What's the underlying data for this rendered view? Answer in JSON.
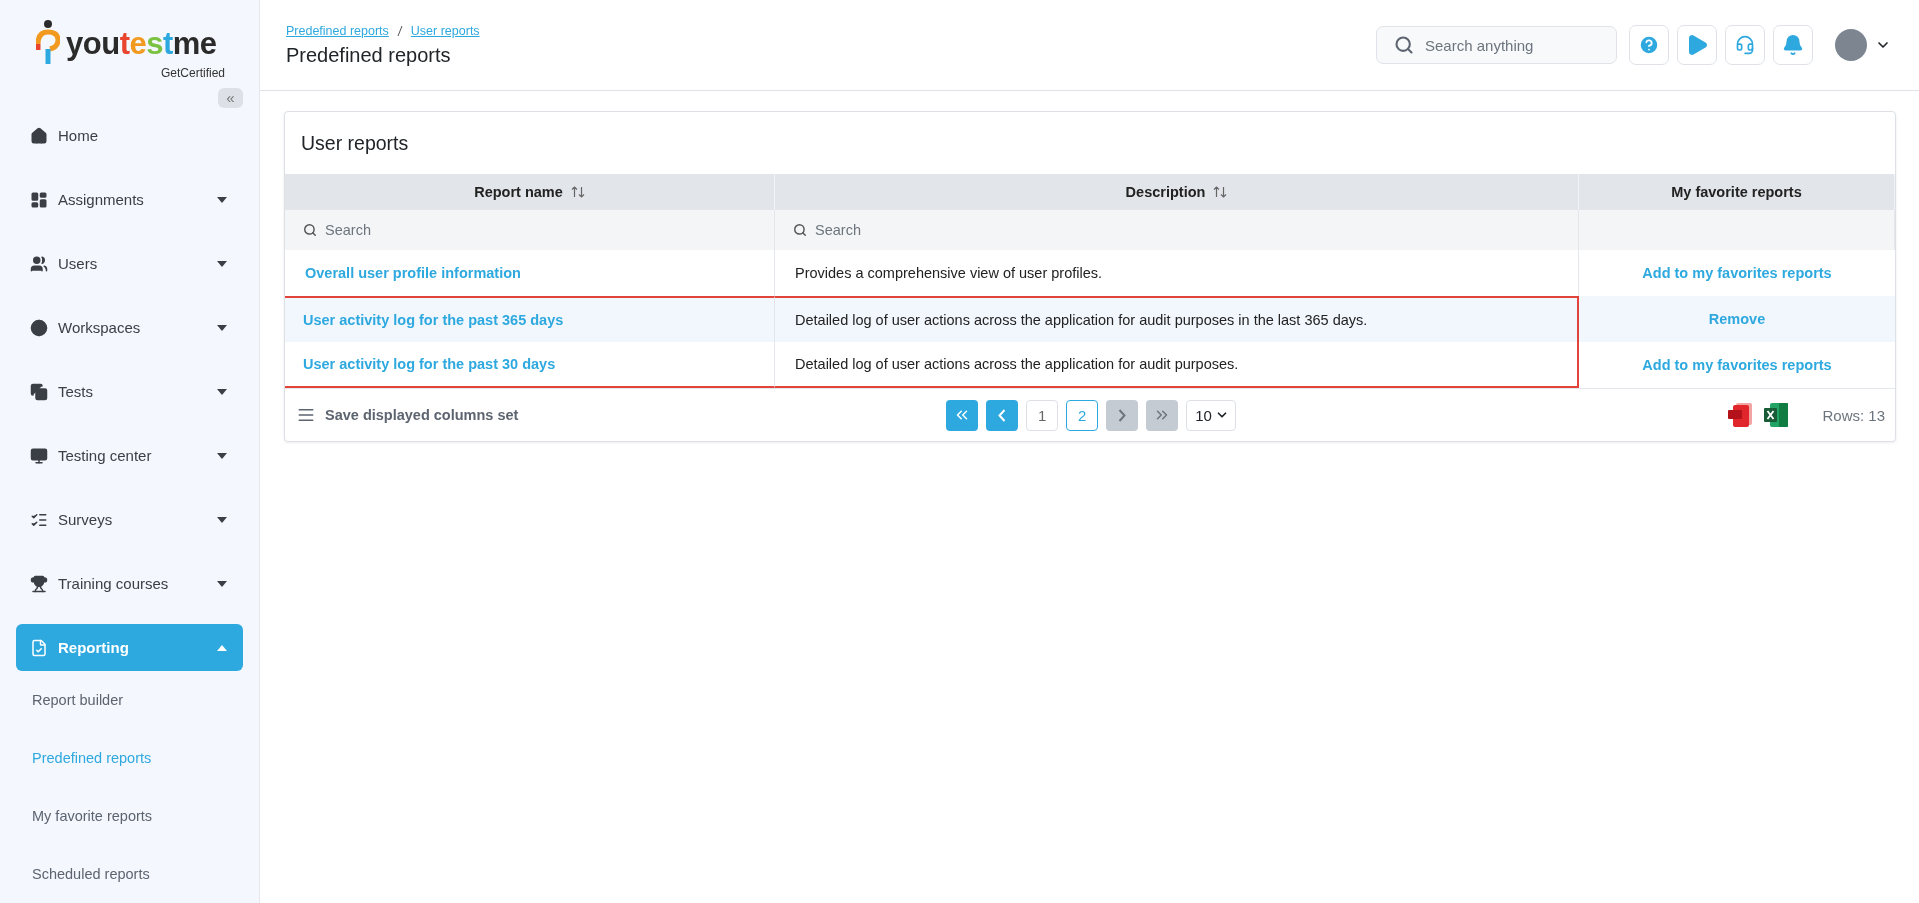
{
  "logo": {
    "parts": [
      {
        "text": "you",
        "color": "#2b2b2b"
      },
      {
        "text": "t",
        "color": "#e8442e"
      },
      {
        "text": "e",
        "color": "#f29a1f"
      },
      {
        "text": "s",
        "color": "#7cc242"
      },
      {
        "text": "t",
        "color": "#2ea9df"
      },
      {
        "text": "me",
        "color": "#2b2b2b"
      }
    ],
    "tagline": "GetCertified"
  },
  "sidebar": {
    "collapse_label": "«",
    "items": [
      {
        "label": "Home",
        "kind": "link",
        "expanded": false,
        "selected": false
      },
      {
        "label": "Assignments",
        "kind": "group",
        "expanded": false,
        "selected": false
      },
      {
        "label": "Users",
        "kind": "group",
        "expanded": false,
        "selected": false
      },
      {
        "label": "Workspaces",
        "kind": "group",
        "expanded": false,
        "selected": false
      },
      {
        "label": "Tests",
        "kind": "group",
        "expanded": false,
        "selected": false
      },
      {
        "label": "Testing center",
        "kind": "group",
        "expanded": false,
        "selected": false
      },
      {
        "label": "Surveys",
        "kind": "group",
        "expanded": false,
        "selected": false
      },
      {
        "label": "Training courses",
        "kind": "group",
        "expanded": false,
        "selected": false
      },
      {
        "label": "Reporting",
        "kind": "group",
        "expanded": true,
        "selected": true,
        "children": [
          {
            "label": "Report builder",
            "selected": false
          },
          {
            "label": "Predefined reports",
            "selected": true
          },
          {
            "label": "My favorite reports",
            "selected": false
          },
          {
            "label": "Scheduled reports",
            "selected": false
          }
        ]
      }
    ]
  },
  "header": {
    "breadcrumbs": [
      "Predefined reports",
      "User reports"
    ],
    "title": "Predefined reports",
    "search": {
      "placeholder": "Search anything"
    }
  },
  "card": {
    "title": "User reports",
    "table": {
      "columns": [
        {
          "label": "Report name",
          "sortable": true
        },
        {
          "label": "Description",
          "sortable": true
        },
        {
          "label": "My favorite reports",
          "sortable": false
        }
      ],
      "filters": [
        {
          "placeholder": "Search"
        },
        {
          "placeholder": "Search"
        }
      ],
      "rows": [
        {
          "name": "Overall user profile information",
          "description": "Provides a comprehensive view of user profiles.",
          "action": "Add to my favorites reports",
          "selected": false,
          "highlighted": false
        },
        {
          "name": "User activity log for the past 365 days",
          "description": "Detailed log of user actions across the application for audit purposes in the last 365 days.",
          "action": "Remove",
          "selected": true,
          "highlighted": true
        },
        {
          "name": "User activity log for the past 30 days",
          "description": "Detailed log of user actions across the application for audit purposes.",
          "action": "Add to my favorites reports",
          "selected": false,
          "highlighted": true
        }
      ]
    },
    "footer": {
      "save_label": "Save displayed columns set",
      "nav_back": [
        {
          "kind": "first",
          "disabled": false
        },
        {
          "kind": "prev",
          "disabled": false
        }
      ],
      "pages": [
        {
          "label": "1",
          "selected": false
        },
        {
          "label": "2",
          "selected": true
        }
      ],
      "nav_forward": [
        {
          "kind": "next",
          "disabled": true
        },
        {
          "kind": "last",
          "disabled": true
        }
      ],
      "page_size": "10",
      "rows_label": "Rows: 13"
    }
  }
}
